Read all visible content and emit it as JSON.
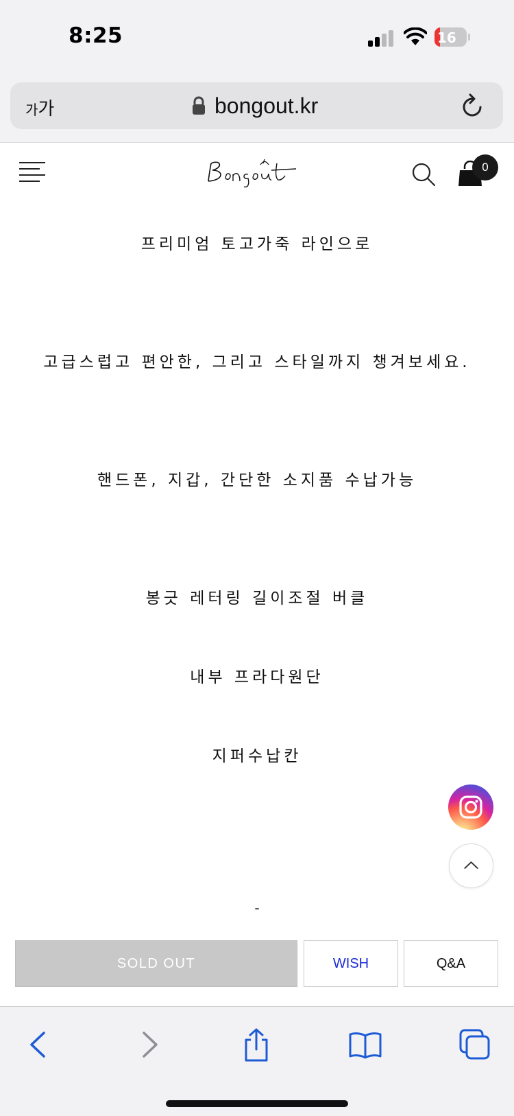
{
  "status_bar": {
    "time": "8:25",
    "battery_level": "16",
    "icons": [
      "signal-icon",
      "wifi-icon",
      "battery-charging-icon"
    ]
  },
  "browser": {
    "text_size_label_small": "가",
    "text_size_label_large": "가",
    "url": "bongout.kr",
    "icons": [
      "lock-icon",
      "reload-icon"
    ]
  },
  "site_header": {
    "logo_text": "Bongout",
    "cart_count": "0",
    "icons": [
      "menu-icon",
      "search-icon",
      "shopping-bag-icon"
    ]
  },
  "description": {
    "lines": [
      "프리미엄 토고가죽 라인으로",
      "고급스럽고 편안한, 그리고 스타일까지 챙겨보세요.",
      "핸드폰, 지갑, 간단한 소지품 수납가능",
      "봉긋 레터링 길이조절 버클",
      "내부 프라다원단",
      "지퍼수납칸",
      "-"
    ]
  },
  "floating": {
    "icons": [
      "instagram-icon",
      "chevron-up-icon"
    ]
  },
  "actions": {
    "sold_out": "SOLD OUT",
    "wish": "WISH",
    "qa": "Q&A"
  },
  "toolbar": {
    "icons": [
      "back-icon",
      "forward-icon",
      "share-icon",
      "bookmarks-icon",
      "tabs-icon"
    ]
  },
  "colors": {
    "accent_blue": "#1d2bd6",
    "sold_out_gray": "#c8c8c8",
    "battery_red": "#e33333"
  }
}
